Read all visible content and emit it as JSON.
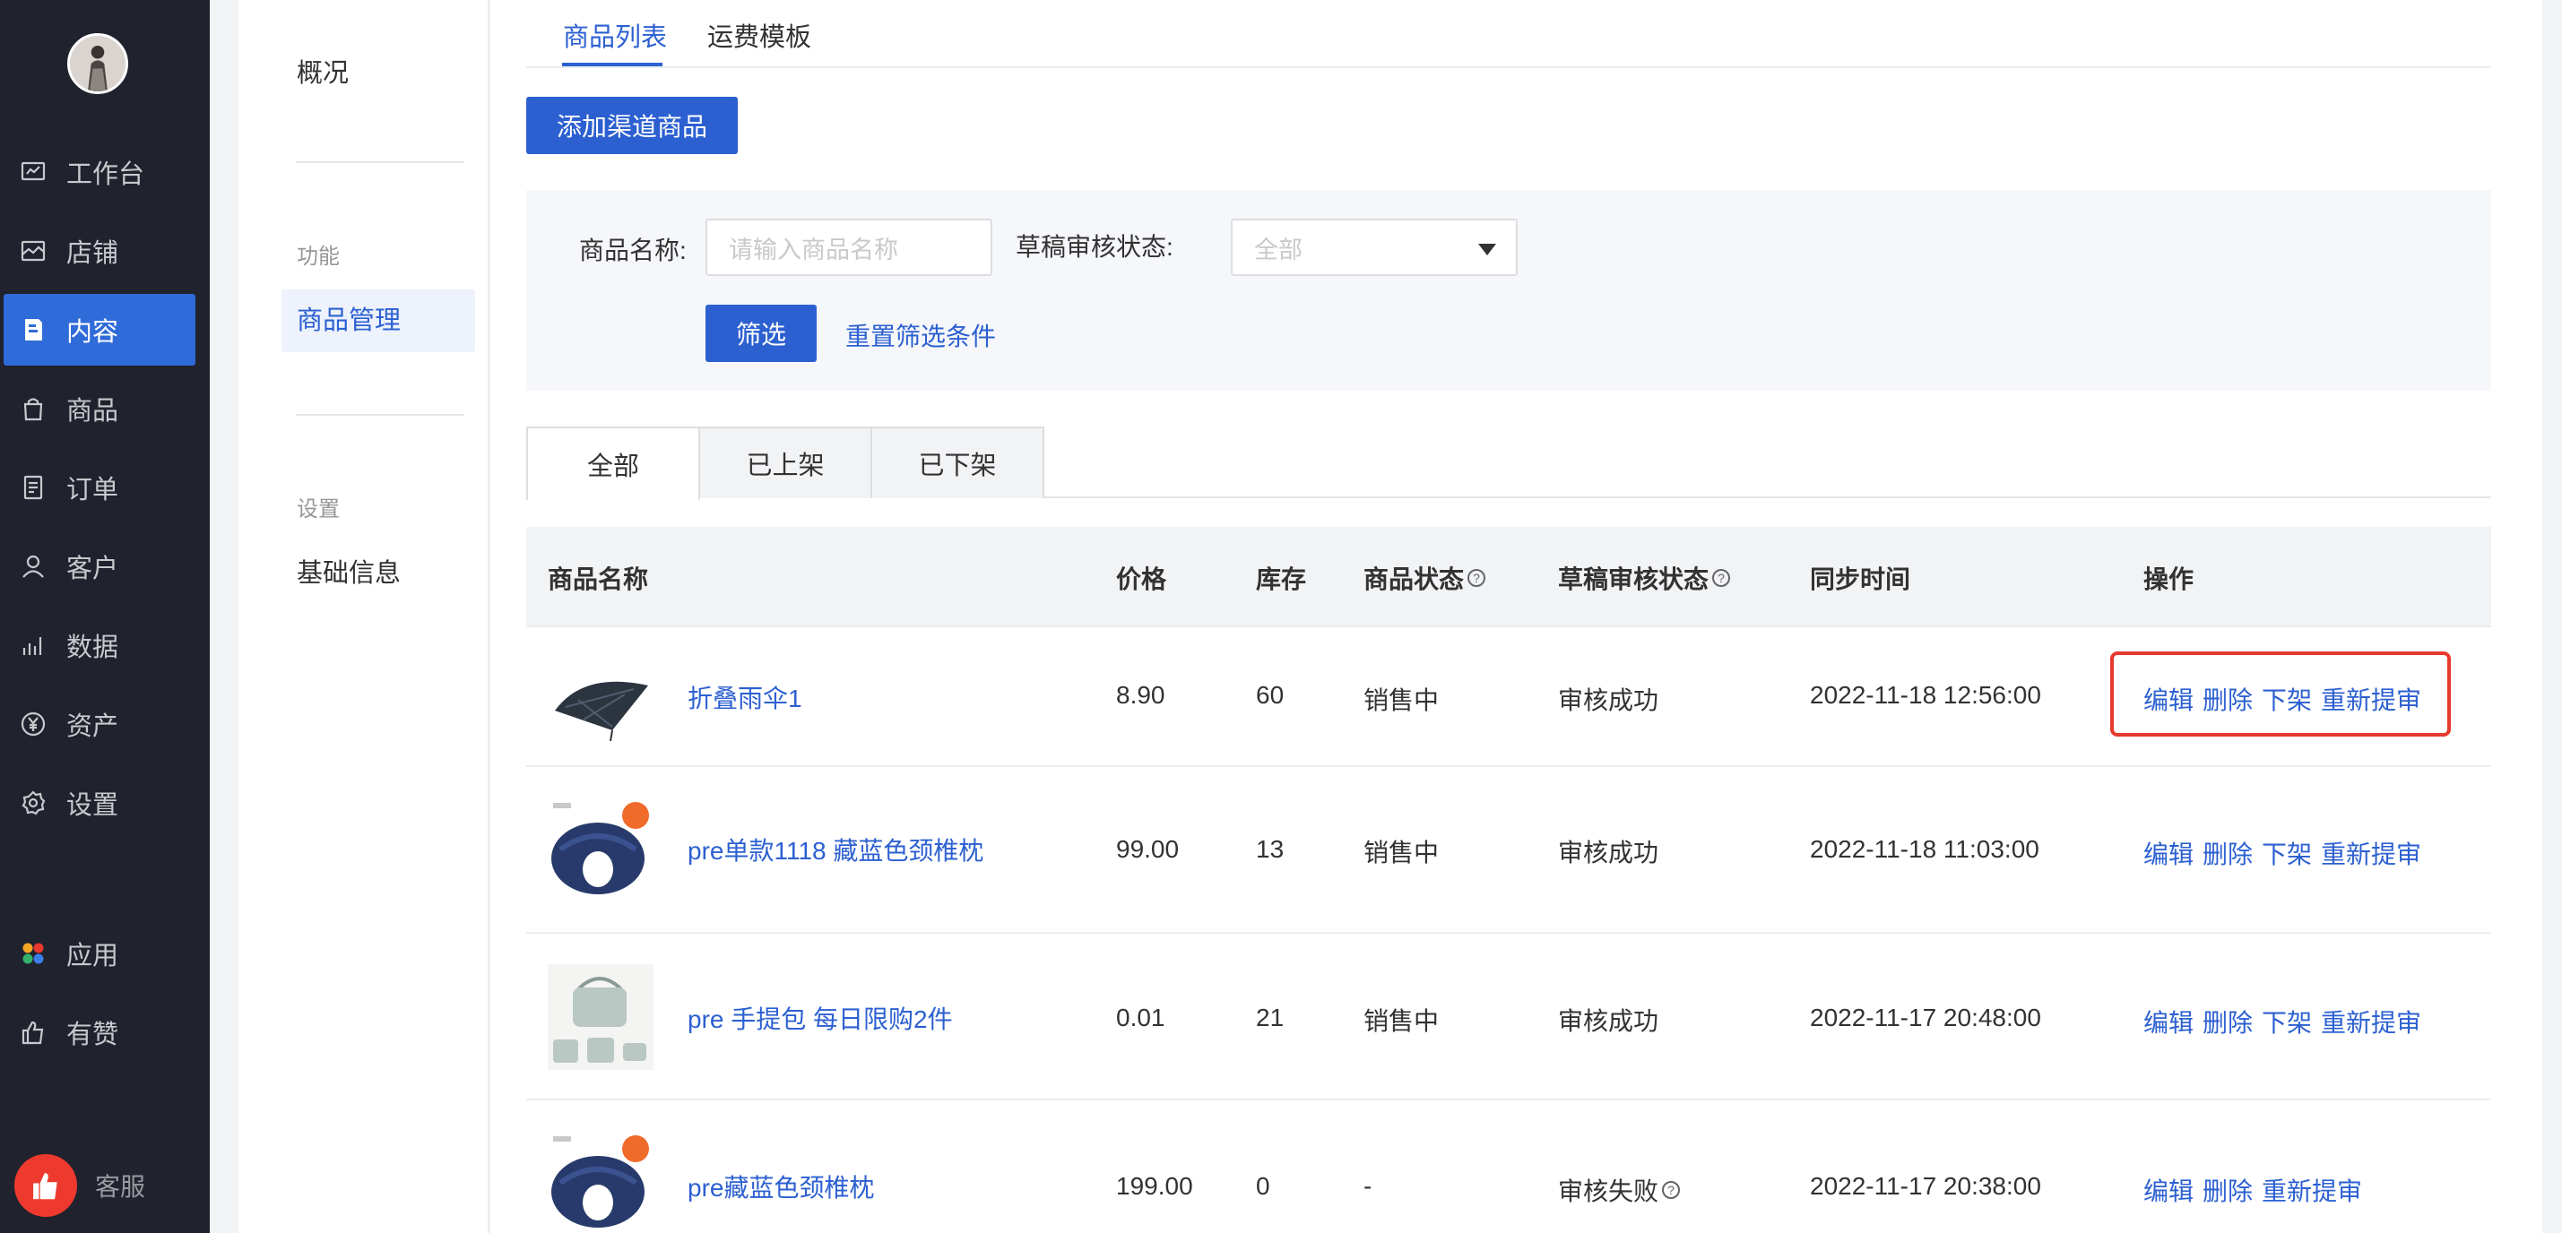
{
  "nav": {
    "items": [
      {
        "label": "工作台",
        "icon": "workbench-icon"
      },
      {
        "label": "店铺",
        "icon": "shop-icon"
      },
      {
        "label": "内容",
        "icon": "content-icon",
        "active": true
      },
      {
        "label": "商品",
        "icon": "bag-icon"
      },
      {
        "label": "订单",
        "icon": "order-icon"
      },
      {
        "label": "客户",
        "icon": "user-icon"
      },
      {
        "label": "数据",
        "icon": "chart-icon"
      },
      {
        "label": "资产",
        "icon": "yen-icon"
      },
      {
        "label": "设置",
        "icon": "gear-icon"
      },
      {
        "label": "应用",
        "icon": "apps-icon"
      },
      {
        "label": "有赞",
        "icon": "thumbs-up-icon"
      }
    ],
    "support_label": "客服"
  },
  "subnav": {
    "overview": "概况",
    "group_function": "功能",
    "item_goods": "商品管理",
    "group_settings": "设置",
    "item_basic": "基础信息"
  },
  "top_tabs": [
    "商品列表",
    "运费模板"
  ],
  "add_button": "添加渠道商品",
  "filter": {
    "name_label": "商品名称:",
    "name_placeholder": "请输入商品名称",
    "status_label": "草稿审核状态:",
    "status_value": "全部",
    "filter_button": "筛选",
    "reset_link": "重置筛选条件"
  },
  "status_tabs": [
    "全部",
    "已上架",
    "已下架"
  ],
  "table": {
    "headers": {
      "name": "商品名称",
      "price": "价格",
      "stock": "库存",
      "status": "商品状态",
      "audit": "草稿审核状态",
      "sync": "同步时间",
      "ops": "操作"
    },
    "rows": [
      {
        "name": "折叠雨伞1",
        "price": "8.90",
        "stock": "60",
        "status": "销售中",
        "audit": "审核成功",
        "sync": "2022-11-18 12:56:00",
        "ops": [
          "编辑",
          "删除",
          "下架",
          "重新提审"
        ],
        "thumb": "umbrella"
      },
      {
        "name": "pre单款1118 藏蓝色颈椎枕",
        "price": "99.00",
        "stock": "13",
        "status": "销售中",
        "audit": "审核成功",
        "sync": "2022-11-18 11:03:00",
        "ops": [
          "编辑",
          "删除",
          "下架",
          "重新提审"
        ],
        "thumb": "pillow"
      },
      {
        "name": "pre 手提包 每日限购2件",
        "price": "0.01",
        "stock": "21",
        "status": "销售中",
        "audit": "审核成功",
        "sync": "2022-11-17 20:48:00",
        "ops": [
          "编辑",
          "删除",
          "下架",
          "重新提审"
        ],
        "thumb": "bag"
      },
      {
        "name": "pre藏蓝色颈椎枕",
        "price": "199.00",
        "stock": "0",
        "status": "-",
        "audit": "审核失败",
        "sync": "2022-11-17 20:38:00",
        "ops": [
          "编辑",
          "删除",
          "重新提审"
        ],
        "thumb": "pillow"
      }
    ]
  },
  "colors": {
    "accent": "#2c60d1",
    "nav_bg": "#20222e",
    "highlight": "#e8392e"
  }
}
